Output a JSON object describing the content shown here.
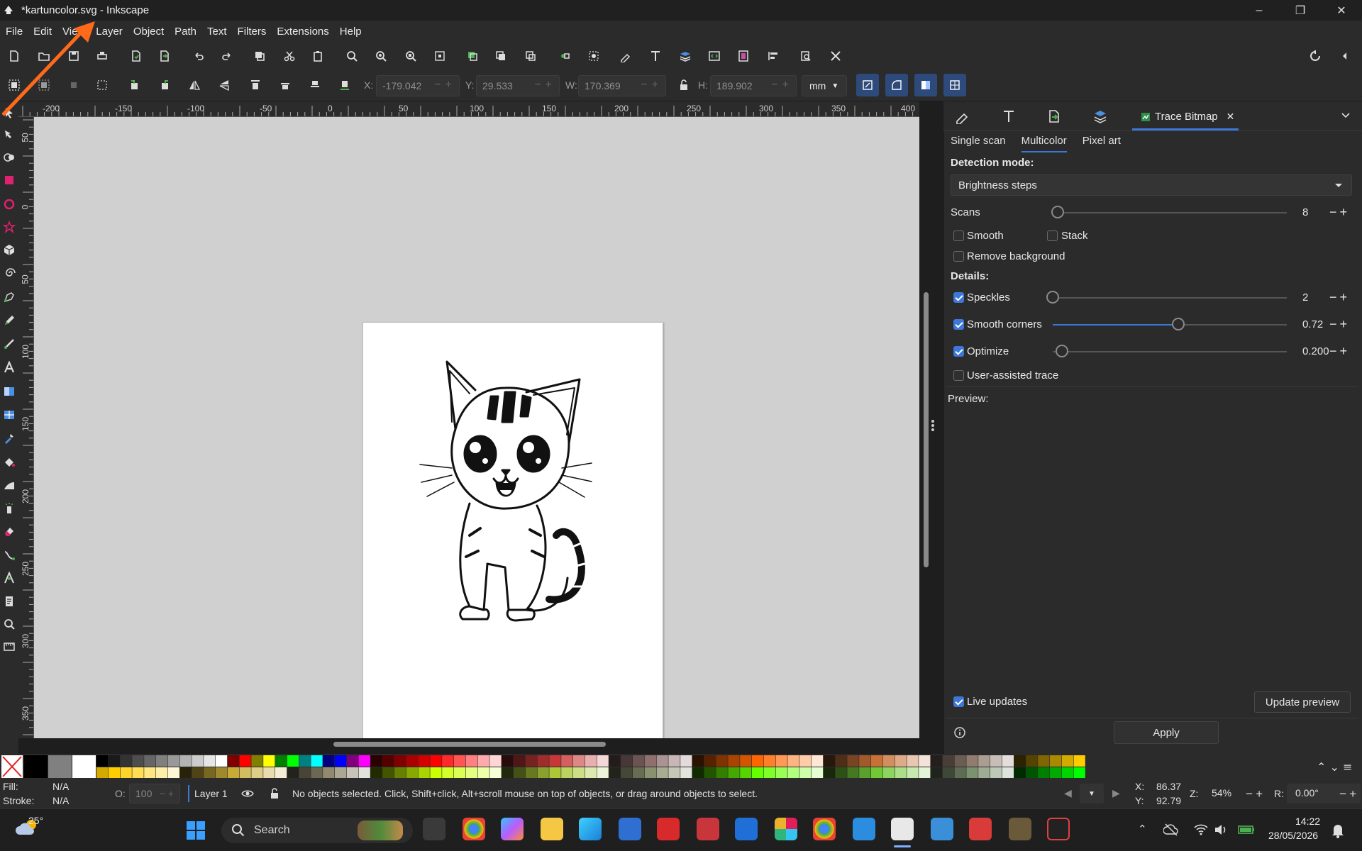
{
  "window": {
    "title": "*kartuncolor.svg - Inkscape",
    "minimize": "–",
    "maximize": "❐",
    "close": "✕"
  },
  "menu": [
    "File",
    "Edit",
    "View",
    "Layer",
    "Object",
    "Path",
    "Text",
    "Filters",
    "Extensions",
    "Help"
  ],
  "controls": {
    "x_label": "X:",
    "x_value": "-179.042",
    "y_label": "Y:",
    "y_value": "29.533",
    "w_label": "W:",
    "w_value": "170.369",
    "h_label": "H:",
    "h_value": "189.902",
    "unit": "mm"
  },
  "rulers": {
    "h_ticks": [
      "-200",
      "-150",
      "-100",
      "-50",
      "0",
      "50",
      "100",
      "150",
      "200",
      "250",
      "300",
      "350",
      "400"
    ],
    "v_ticks": [
      "50",
      "0",
      "50",
      "100",
      "150",
      "200",
      "250",
      "300",
      "350"
    ]
  },
  "panel": {
    "active_tab": "Trace Bitmap",
    "subtabs": [
      "Single scan",
      "Multicolor",
      "Pixel art"
    ],
    "active_subtab": "Multicolor",
    "detection_mode_label": "Detection mode:",
    "detection_mode_value": "Brightness steps",
    "scans_label": "Scans",
    "scans_value": "8",
    "smooth_label": "Smooth",
    "stack_label": "Stack",
    "remove_bg_label": "Remove background",
    "details_label": "Details:",
    "speckles_label": "Speckles",
    "speckles_value": "2",
    "smooth_corners_label": "Smooth corners",
    "smooth_corners_value": "0.72",
    "optimize_label": "Optimize",
    "optimize_value": "0.200",
    "user_assisted_label": "User-assisted trace",
    "preview_label": "Preview:",
    "live_updates_label": "Live updates",
    "update_preview_label": "Update preview",
    "apply_label": "Apply"
  },
  "status": {
    "fill_label": "Fill:",
    "fill_value": "N/A",
    "stroke_label": "Stroke:",
    "stroke_value": "N/A",
    "opacity_label": "O:",
    "opacity_value": "100",
    "layer": "Layer 1",
    "message": "No objects selected. Click, Shift+click, Alt+scroll mouse on top of objects, or drag around objects to select.",
    "x_label": "X:",
    "x_value": "86.37",
    "y_label": "Y:",
    "y_value": "92.79",
    "zoom_label": "Z:",
    "zoom_value": "54%",
    "rotation_label": "R:",
    "rotation_value": "0.00°"
  },
  "taskbar": {
    "weather": "25°",
    "search_placeholder": "Search",
    "time": "14:22",
    "date": "28/05/2026"
  },
  "colors": {
    "accent": "#3d78d8",
    "annotation_arrow": "#ff6a1a"
  }
}
